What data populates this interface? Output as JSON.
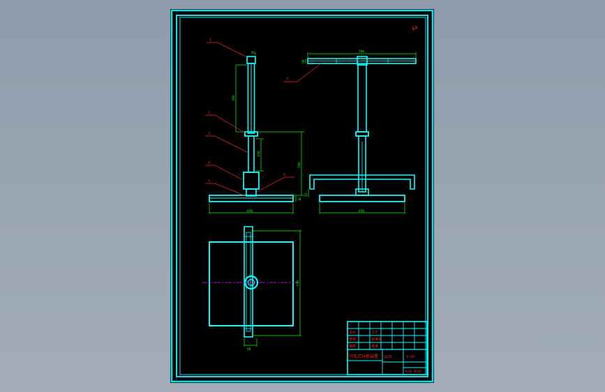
{
  "viewport": {
    "background": "#97a2b1"
  },
  "drawing": {
    "sheet_color": "#000000",
    "frame_color": "#00e5ee",
    "geometry_color": "#00ffff",
    "dimension_color": "#00ff00",
    "leader_color": "#ff0000",
    "centerline_color": "#ff00ff",
    "corner_mark": "A4",
    "front_view": {
      "callouts": [
        "1",
        "2",
        "3",
        "4",
        "5",
        "6"
      ],
      "dims": [
        "85",
        "360",
        "110",
        "240",
        "20",
        "850"
      ]
    },
    "side_view": {
      "callouts": [
        "7"
      ],
      "dims": [
        "700",
        "50",
        "650",
        "15"
      ]
    },
    "top_view": {
      "dims": [
        "650",
        "40"
      ]
    },
    "title_block": {
      "cells": [
        "设计",
        "校核",
        "审核",
        "工艺",
        "标准化",
        "批准"
      ],
      "drawing_name": "行车式分拣装置",
      "material": "Q235",
      "scale": "1:10",
      "sheet_no": "共1张 第1张"
    }
  }
}
